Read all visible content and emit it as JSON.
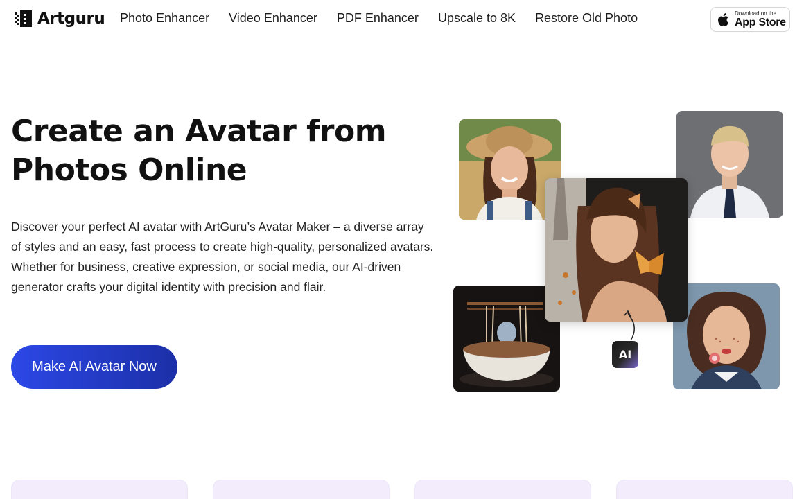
{
  "nav": {
    "logo_text": "Artguru",
    "links": [
      {
        "label": "Photo Enhancer"
      },
      {
        "label": "Video Enhancer"
      },
      {
        "label": "PDF Enhancer"
      },
      {
        "label": "Upscale to 8K"
      },
      {
        "label": "Restore Old Photo"
      }
    ],
    "appstore": {
      "small": "Download on the",
      "big": "App Store",
      "icon": "apple-icon"
    }
  },
  "hero": {
    "title_line1": "Create an Avatar from",
    "title_line2": "Photos Online",
    "description": "Discover your perfect AI avatar with ArtGuru’s Avatar Maker – a diverse array of styles and an easy, fast process to create high-quality, personalized avatars. Whether for business, creative expression, or social media, our AI-driven generator crafts your digital identity with precision and flair.",
    "cta_label": "Make AI Avatar Now"
  },
  "collage": {
    "ai_badge": "AI"
  },
  "colors": {
    "cta_start": "#2c48e6",
    "cta_end": "#1c2fa8",
    "card_bg": "#f2ecfc"
  }
}
